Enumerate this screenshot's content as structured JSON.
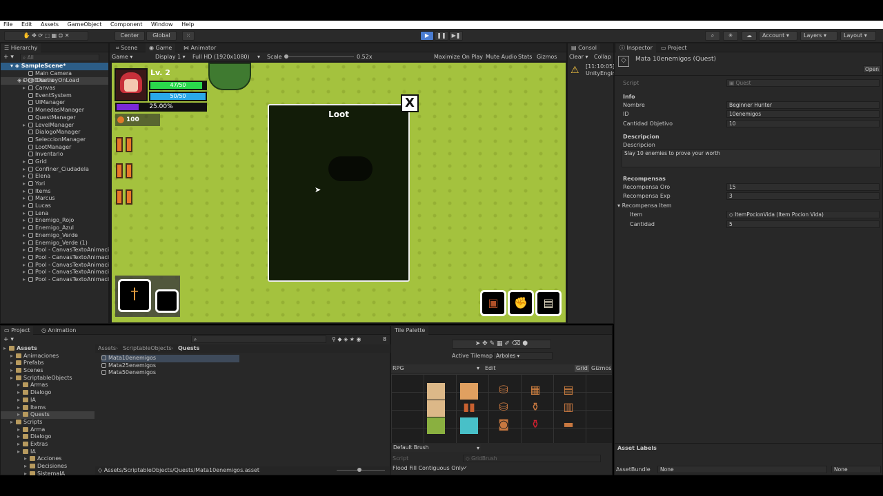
{
  "menu": [
    "File",
    "Edit",
    "Assets",
    "GameObject",
    "Component",
    "Window",
    "Help"
  ],
  "toolbar": {
    "center": "Center",
    "global": "Global",
    "account": "Account",
    "layers": "Layers",
    "layout": "Layout"
  },
  "hierarchy": {
    "tab": "Hierarchy",
    "search_placeholder": "All",
    "scene": "SampleScene*",
    "items": [
      "Main Camera",
      "Titania",
      "Canvas",
      "EventSystem",
      "UIManager",
      "MonedasManager",
      "QuestManager",
      "LevelManager",
      "DialogoManager",
      "SeleccionManager",
      "LootManager",
      "Inventario",
      "Grid",
      "Confiner_Ciudadela",
      "Elena",
      "Yori",
      "Items",
      "Marcus",
      "Lucas",
      "Lena",
      "Enemigo_Rojo",
      "Enemigo_Azul",
      "Enemigo_Verde",
      "Enemigo_Verde (1)",
      "Pool - CanvasTextoAnimaci",
      "Pool - CanvasTextoAnimaci",
      "Pool - CanvasTextoAnimaci",
      "Pool - CanvasTextoAnimaci",
      "Pool - CanvasTextoAnimaci"
    ],
    "dont_destroy": "DontDestroyOnLoad"
  },
  "game": {
    "tabs": [
      "Scene",
      "Game",
      "Animator"
    ],
    "mode": "Game",
    "display": "Display 1",
    "resolution": "Full HD (1920x1080)",
    "scale_label": "Scale",
    "scale_value": "0.52x",
    "toggles": [
      "Maximize On Play",
      "Mute Audio",
      "Stats",
      "Gizmos"
    ],
    "level": "Lv. 2",
    "health": "47/50",
    "mana": "50/50",
    "exp": "25.00%",
    "coins": "100",
    "loot_title": "Loot",
    "close": "X",
    "health_frac": 0.94,
    "mana_frac": 1.0,
    "exp_frac": 0.25
  },
  "console": {
    "tab": "Consol",
    "clear": "Clear",
    "collapse": "Collap",
    "time": "[11:10:05]",
    "source": "UnityEngin"
  },
  "inspector": {
    "tabs": [
      "Inspector",
      "Project"
    ],
    "title": "Mata 10enemigos (Quest)",
    "open": "Open",
    "script_label": "Script",
    "script_value": "Quest",
    "info_header": "Info",
    "nombre_label": "Nombre",
    "nombre": "Beginner Hunter",
    "id_label": "ID",
    "id": "10enemigos",
    "cantidad_label": "Cantidad Objetivo",
    "cantidad": "10",
    "desc_header": "Descripcion",
    "desc_label": "Descripcion",
    "desc": "Slay 10 enemies to prove your worth",
    "rec_header": "Recompensas",
    "oro_label": "Recompensa Oro",
    "oro": "15",
    "exp_label": "Recompensa Exp",
    "exp": "3",
    "item_header": "Recompensa Item",
    "item_label": "Item",
    "item": "ItemPocionVida (Item Pocion Vida)",
    "cant_label": "Cantidad",
    "cant": "5",
    "asset_labels": "Asset Labels",
    "bundle_label": "AssetBundle",
    "bundle": "None",
    "variant": "None"
  },
  "project": {
    "tabs": [
      "Project",
      "Animation"
    ],
    "tree": [
      {
        "name": "Assets",
        "level": 0,
        "bold": true
      },
      {
        "name": "Animaciones",
        "level": 1
      },
      {
        "name": "Prefabs",
        "level": 1
      },
      {
        "name": "Scenes",
        "level": 1
      },
      {
        "name": "ScriptableObjects",
        "level": 1
      },
      {
        "name": "Armas",
        "level": 2
      },
      {
        "name": "Dialogo",
        "level": 2
      },
      {
        "name": "IA",
        "level": 2
      },
      {
        "name": "Items",
        "level": 2
      },
      {
        "name": "Quests",
        "level": 2
      },
      {
        "name": "Scripts",
        "level": 1
      },
      {
        "name": "Arma",
        "level": 2
      },
      {
        "name": "Dialogo",
        "level": 2
      },
      {
        "name": "Extras",
        "level": 2
      },
      {
        "name": "IA",
        "level": 2
      },
      {
        "name": "Acciones",
        "level": 3
      },
      {
        "name": "Decisiones",
        "level": 3
      },
      {
        "name": "SistemaIA",
        "level": 3
      }
    ],
    "breadcrumb": [
      "Assets",
      "ScriptableObjects",
      "Quests"
    ],
    "files": [
      "Mata10enemigos",
      "Mata25enemigos",
      "Mata50enemigos"
    ],
    "path": "Assets/ScriptableObjects/Quests/Mata10enemigos.asset",
    "count": "8"
  },
  "tile": {
    "tab": "Tile Palette",
    "active_label": "Active Tilemap",
    "active": "Arboles",
    "palette": "RPG",
    "edit": "Edit",
    "grid": "Grid",
    "gizmos": "Gizmos",
    "brush": "Default Brush",
    "script_label": "Script",
    "script": "GridBrush",
    "flood": "Flood Fill Contiguous Only"
  },
  "colors": {
    "grass": "#a4c23e",
    "hp": "#2ad84c",
    "mp": "#2aa8e8",
    "xp": "#7a2ad8",
    "accent": "#4a7cd0"
  }
}
